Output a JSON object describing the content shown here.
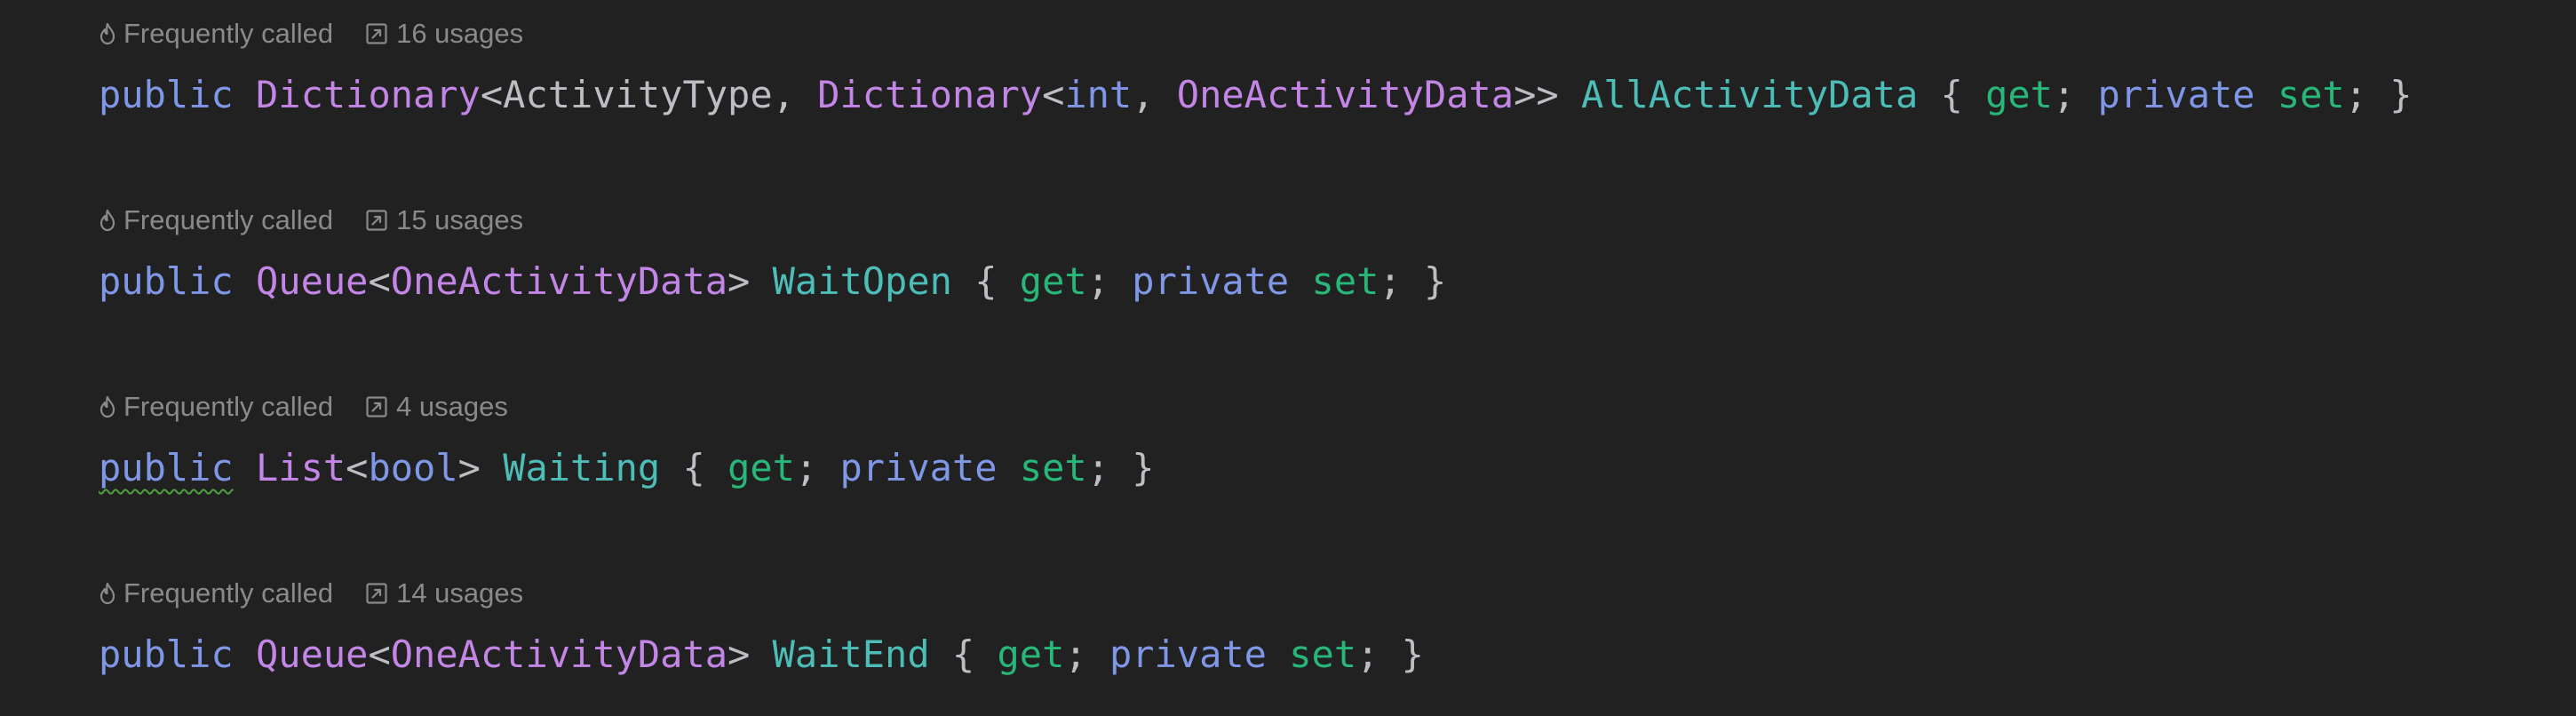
{
  "theme": {
    "background": "#212121",
    "hint_text": "#8a8a8a",
    "keyword": "#7f97e6",
    "type": "#c486e6",
    "property": "#4dbdb8",
    "accessor": "#27b879",
    "punctuation": "#bcbec4",
    "warning_underline": "#4f9f3f"
  },
  "declarations": [
    {
      "hint": {
        "frequency_icon": "flame-icon",
        "frequency_label": "Frequently called",
        "usages_icon": "external-link-icon",
        "usages_label": "16 usages"
      },
      "tokens": [
        {
          "text": "public",
          "kind": "kw"
        },
        {
          "text": " ",
          "kind": "punc"
        },
        {
          "text": "Dictionary",
          "kind": "type"
        },
        {
          "text": "<ActivityType, ",
          "kind": "punc"
        },
        {
          "text": "Dictionary",
          "kind": "type"
        },
        {
          "text": "<",
          "kind": "punc"
        },
        {
          "text": "int",
          "kind": "kw"
        },
        {
          "text": ", ",
          "kind": "punc"
        },
        {
          "text": "OneActivityData",
          "kind": "type"
        },
        {
          "text": ">> ",
          "kind": "punc"
        },
        {
          "text": "AllActivityData",
          "kind": "prop"
        },
        {
          "text": " { ",
          "kind": "punc"
        },
        {
          "text": "get",
          "kind": "acc"
        },
        {
          "text": "; ",
          "kind": "punc"
        },
        {
          "text": "private",
          "kind": "kw"
        },
        {
          "text": " ",
          "kind": "punc"
        },
        {
          "text": "set",
          "kind": "acc"
        },
        {
          "text": "; }",
          "kind": "punc"
        }
      ]
    },
    {
      "hint": {
        "frequency_icon": "flame-icon",
        "frequency_label": "Frequently called",
        "usages_icon": "external-link-icon",
        "usages_label": "15 usages"
      },
      "tokens": [
        {
          "text": "public",
          "kind": "kw"
        },
        {
          "text": " ",
          "kind": "punc"
        },
        {
          "text": "Queue",
          "kind": "type"
        },
        {
          "text": "<",
          "kind": "punc"
        },
        {
          "text": "OneActivityData",
          "kind": "type"
        },
        {
          "text": "> ",
          "kind": "punc"
        },
        {
          "text": "WaitOpen",
          "kind": "prop"
        },
        {
          "text": " { ",
          "kind": "punc"
        },
        {
          "text": "get",
          "kind": "acc"
        },
        {
          "text": "; ",
          "kind": "punc"
        },
        {
          "text": "private",
          "kind": "kw"
        },
        {
          "text": " ",
          "kind": "punc"
        },
        {
          "text": "set",
          "kind": "acc"
        },
        {
          "text": "; }",
          "kind": "punc"
        }
      ]
    },
    {
      "hint": {
        "frequency_icon": "flame-icon",
        "frequency_label": "Frequently called",
        "usages_icon": "external-link-icon",
        "usages_label": "4 usages"
      },
      "tokens": [
        {
          "text": "public",
          "kind": "kw",
          "warn": true
        },
        {
          "text": " ",
          "kind": "punc"
        },
        {
          "text": "List",
          "kind": "type"
        },
        {
          "text": "<",
          "kind": "punc"
        },
        {
          "text": "bool",
          "kind": "kw"
        },
        {
          "text": "> ",
          "kind": "punc"
        },
        {
          "text": "Waiting",
          "kind": "prop"
        },
        {
          "text": " { ",
          "kind": "punc"
        },
        {
          "text": "get",
          "kind": "acc"
        },
        {
          "text": "; ",
          "kind": "punc"
        },
        {
          "text": "private",
          "kind": "kw"
        },
        {
          "text": " ",
          "kind": "punc"
        },
        {
          "text": "set",
          "kind": "acc"
        },
        {
          "text": "; }",
          "kind": "punc"
        }
      ]
    },
    {
      "hint": {
        "frequency_icon": "flame-icon",
        "frequency_label": "Frequently called",
        "usages_icon": "external-link-icon",
        "usages_label": "14 usages"
      },
      "tokens": [
        {
          "text": "public",
          "kind": "kw"
        },
        {
          "text": " ",
          "kind": "punc"
        },
        {
          "text": "Queue",
          "kind": "type"
        },
        {
          "text": "<",
          "kind": "punc"
        },
        {
          "text": "OneActivityData",
          "kind": "type"
        },
        {
          "text": "> ",
          "kind": "punc"
        },
        {
          "text": "WaitEnd",
          "kind": "prop"
        },
        {
          "text": " { ",
          "kind": "punc"
        },
        {
          "text": "get",
          "kind": "acc"
        },
        {
          "text": "; ",
          "kind": "punc"
        },
        {
          "text": "private",
          "kind": "kw"
        },
        {
          "text": " ",
          "kind": "punc"
        },
        {
          "text": "set",
          "kind": "acc"
        },
        {
          "text": "; }",
          "kind": "punc"
        }
      ]
    }
  ]
}
